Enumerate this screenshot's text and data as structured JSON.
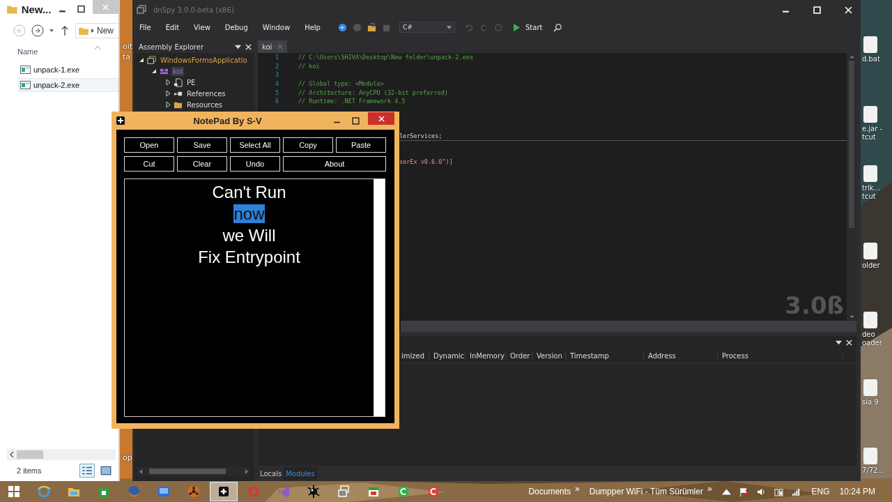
{
  "desktop": {
    "left_labels": [
      "oit",
      "ta",
      "op"
    ],
    "right_icons": [
      {
        "lines": [
          "d.bat"
        ]
      },
      {
        "lines": [
          "e.jar -",
          "tcut"
        ]
      },
      {
        "lines": [
          "trik...",
          "tcut"
        ]
      },
      {
        "lines": [
          "older"
        ]
      },
      {
        "lines": [
          "deo",
          "oader"
        ]
      },
      {
        "lines": [
          "sia 9"
        ]
      },
      {
        "lines": [
          "7/72..."
        ]
      }
    ]
  },
  "explorer": {
    "title": "New...",
    "address": "New",
    "column": "Name",
    "files": [
      {
        "name": "unpack-1.exe",
        "selected": false
      },
      {
        "name": "unpack-2.exe",
        "selected": true
      }
    ],
    "status": "2 items"
  },
  "dnspy": {
    "title": "dnSpy 3.0.0-beta (x86)",
    "menu": [
      "File",
      "Edit",
      "View",
      "Debug",
      "Window",
      "Help"
    ],
    "language": "C#",
    "start": "Start",
    "assembly_explorer": {
      "title": "Assembly Explorer",
      "tree": [
        {
          "label": "WindowsFormsApplicatio",
          "expanded": true,
          "selected": false,
          "children": [
            {
              "label": "koi",
              "expanded": true,
              "selected": true,
              "children": [
                {
                  "label": "PE",
                  "expanded": false,
                  "selected": false
                },
                {
                  "label": "References",
                  "expanded": false,
                  "selected": false
                },
                {
                  "label": "Resources",
                  "expanded": false,
                  "selected": false
                }
              ]
            }
          ]
        }
      ]
    },
    "editor": {
      "tab": "koi",
      "lines": [
        {
          "number": "1",
          "text": "// C:\\Users\\SHIVA\\Desktop\\New folder\\unpack-2.exe"
        },
        {
          "number": "2",
          "text": "// koi"
        },
        {
          "number": "3"
        },
        {
          "number": "4",
          "text": "// Global type: <Module>"
        },
        {
          "number": "5",
          "text": "// Architecture: AnyCPU (32-bit preferred)"
        },
        {
          "number": "6",
          "text": "// Runtime: .NET Framework 4.5"
        }
      ],
      "fragments": [
        "lerServices;",
        "serEx v0.6.0\")]"
      ],
      "version_mark": "3.0ß"
    },
    "modules": {
      "columns": [
        "imized",
        "Dynamic",
        "InMemory",
        "Order",
        "Version",
        "Timestamp",
        "Address",
        "Process"
      ]
    },
    "bottom_tabs": [
      {
        "label": "Locals",
        "selected": false
      },
      {
        "label": "Modules",
        "selected": true
      }
    ]
  },
  "notepad": {
    "title": "NotePad By S-V",
    "buttons": [
      "Open",
      "Save",
      "Select All",
      "Copy",
      "Paste",
      "Cut",
      "Clear",
      "Undo",
      "About"
    ],
    "text_lines": [
      {
        "parts": [
          {
            "text": "Can't Run",
            "selected": false
          }
        ]
      },
      {
        "parts": [
          {
            "text": "now",
            "selected": true
          }
        ]
      },
      {
        "parts": [
          {
            "text": "we Will",
            "selected": false
          }
        ]
      },
      {
        "parts": [
          {
            "text": "Fix Entrypoint",
            "selected": false
          }
        ]
      }
    ]
  },
  "taskbar": {
    "apps": [
      {
        "kind": "start",
        "active": false
      },
      {
        "kind": "browser",
        "active": false
      },
      {
        "kind": "folder",
        "active": false
      },
      {
        "kind": "store",
        "active": false
      },
      {
        "kind": "firefox",
        "active": false
      },
      {
        "kind": "screen",
        "active": false
      },
      {
        "kind": "hazard",
        "active": false
      },
      {
        "kind": "notepad",
        "active": true
      },
      {
        "kind": "sync",
        "active": false
      },
      {
        "kind": "vs",
        "active": false
      },
      {
        "kind": "splat",
        "active": false
      },
      {
        "kind": "windows",
        "active": false
      },
      {
        "kind": "calendar",
        "active": false
      },
      {
        "kind": "cgreen",
        "active": false
      },
      {
        "kind": "cred",
        "active": false
      }
    ],
    "toolbars": [
      "Documents",
      "»",
      "Dumpper WiFi - Tüm Sürümler",
      "»"
    ],
    "language": "ENG",
    "time": "10:24 PM"
  }
}
